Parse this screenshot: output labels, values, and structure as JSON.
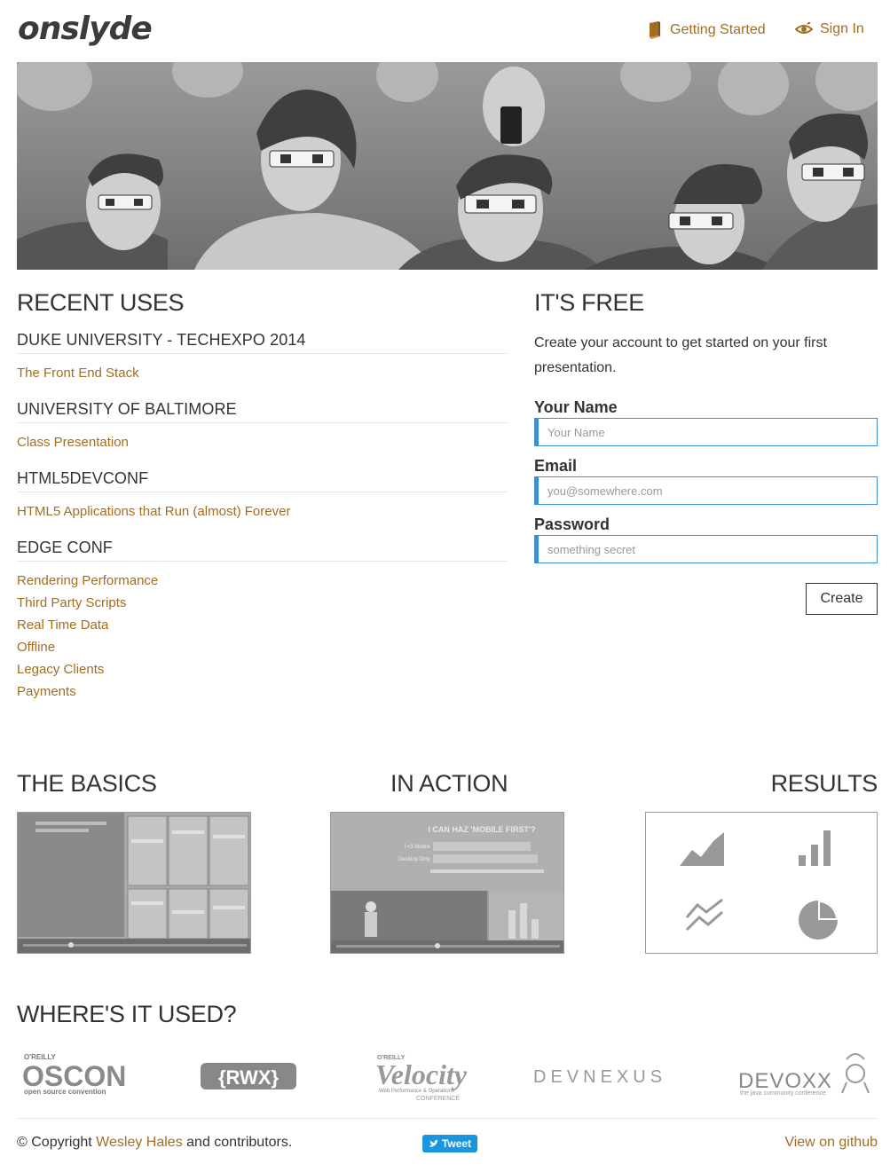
{
  "header": {
    "logo": "onslyde",
    "getting_started": "Getting Started",
    "sign_in": "Sign In"
  },
  "recent": {
    "heading": "RECENT USES",
    "events": [
      {
        "title": "DUKE UNIVERSITY - TECHEXPO 2014",
        "talks": [
          "The Front End Stack"
        ]
      },
      {
        "title": "UNIVERSITY OF BALTIMORE",
        "talks": [
          "Class Presentation"
        ]
      },
      {
        "title": "HTML5DEVCONF",
        "talks": [
          "HTML5 Applications that Run (almost) Forever"
        ]
      },
      {
        "title": "EDGE CONF",
        "talks": [
          "Rendering Performance",
          "Third Party Scripts",
          "Real Time Data",
          "Offline",
          "Legacy Clients",
          "Payments"
        ]
      }
    ]
  },
  "signup": {
    "heading": "IT'S FREE",
    "intro": "Create your account to get started on your first presentation.",
    "name_label": "Your Name",
    "name_placeholder": "Your Name",
    "email_label": "Email",
    "email_placeholder": "you@somewhere.com",
    "password_label": "Password",
    "password_placeholder": "something secret",
    "create_button": "Create"
  },
  "media": {
    "basics_heading": "THE BASICS",
    "action_heading": "IN ACTION",
    "results_heading": "RESULTS",
    "action_slide_title": "I CAN HAZ 'MOBILE FIRST'?",
    "action_row1": "I <3 Mobile",
    "action_row2": "Desktop Only"
  },
  "where_used": {
    "heading": "WHERE'S IT USED?",
    "logos": [
      "OSCON",
      "{RWX}",
      "Velocity",
      "DEVNEXUS",
      "DEVOXX"
    ]
  },
  "footer": {
    "copyright_prefix": "© Copyright",
    "author": "Wesley Hales",
    "copyright_suffix": "and contributors.",
    "tweet": "Tweet",
    "github": "View on github"
  },
  "colors": {
    "link": "#a36d22",
    "input_border": "#3d8fd6",
    "tweet": "#1b95e0"
  }
}
